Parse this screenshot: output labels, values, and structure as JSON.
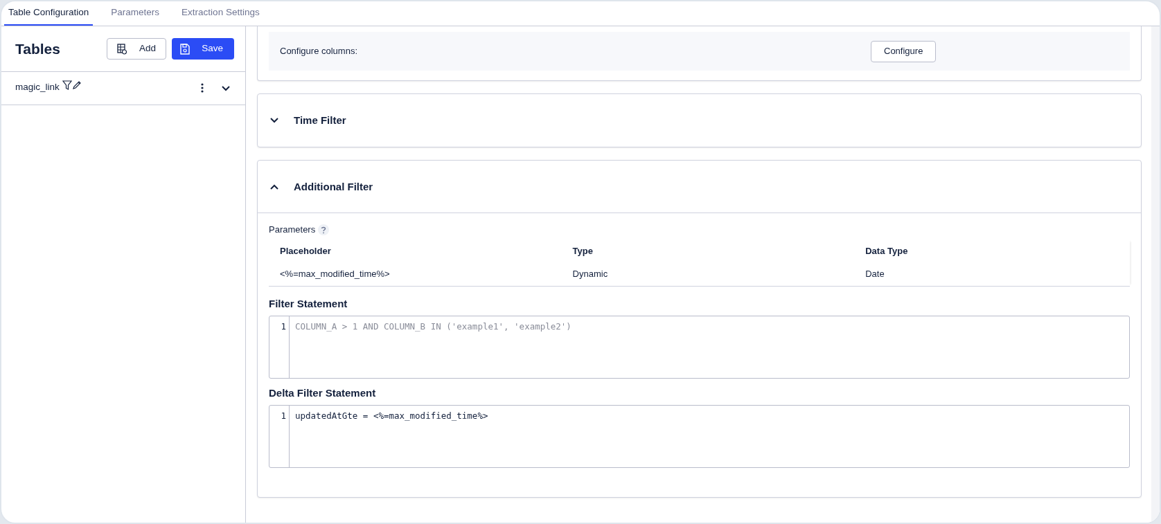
{
  "tabs": [
    {
      "label": "Table Configuration",
      "selected": true
    },
    {
      "label": "Parameters",
      "selected": false
    },
    {
      "label": "Extraction Settings",
      "selected": false
    }
  ],
  "sidebar": {
    "title": "Tables",
    "add_button": "Add",
    "save_button": "Save",
    "tables": [
      {
        "name": "magic_link",
        "expanded": false
      }
    ]
  },
  "columns_card": {
    "label": "Configure columns:",
    "button": "Configure"
  },
  "filters": [
    {
      "title": "Time Filter",
      "expanded": false
    },
    {
      "title": "Additional Filter",
      "expanded": true,
      "parameters_label": "Parameters",
      "columns": [
        "Placeholder",
        "Type",
        "Data Type"
      ],
      "rows": [
        [
          "<%=max_modified_time%>",
          "Dynamic",
          "Date"
        ]
      ],
      "statements": [
        {
          "title": "Filter Statement",
          "line_number": "1",
          "placeholder": "COLUMN_A > 1 AND COLUMN_B IN ('example1', 'example2')"
        },
        {
          "title": "Delta Filter Statement",
          "line_number": "1",
          "value": "updatedAtGte = <%=max_modified_time%>"
        }
      ]
    }
  ]
}
